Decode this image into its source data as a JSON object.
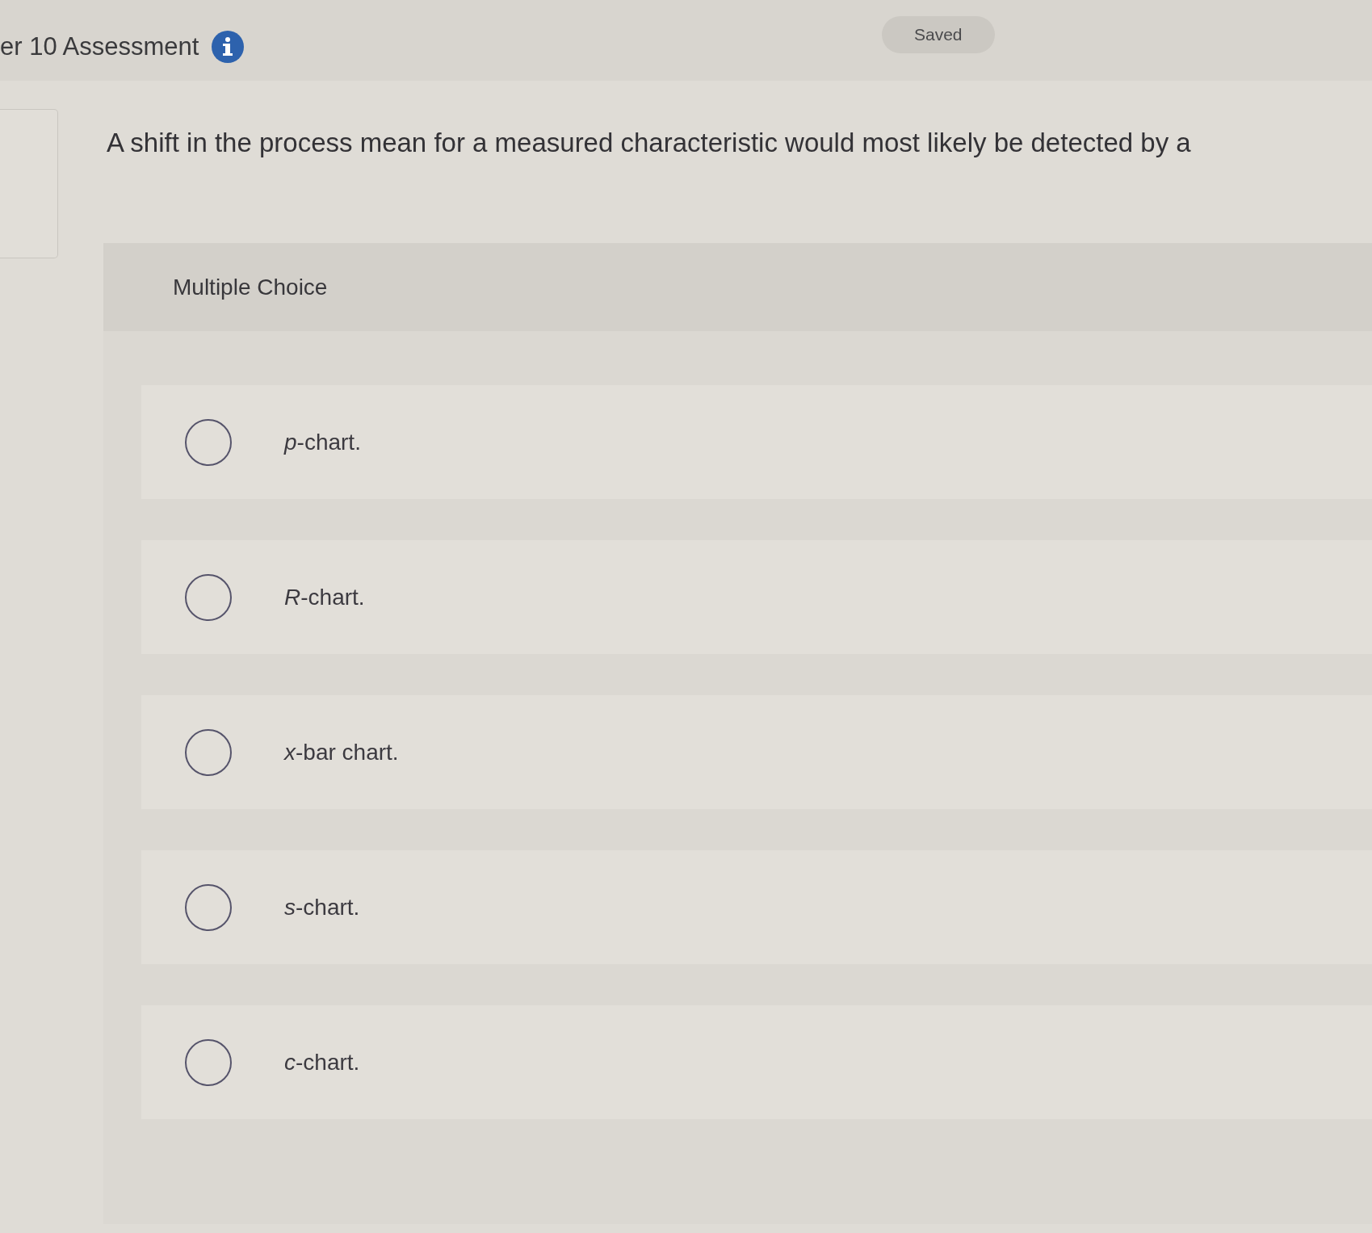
{
  "header": {
    "title": "er 10 Assessment",
    "status": "Saved"
  },
  "question": {
    "prompt": "A shift in the process mean for a measured characteristic would most likely be detected by a",
    "type_label": "Multiple Choice",
    "options": [
      {
        "label": "*p*-chart.",
        "selected": false
      },
      {
        "label": "*R*-chart.",
        "selected": false
      },
      {
        "label": "*x*-bar chart.",
        "selected": false
      },
      {
        "label": "*s*-chart.",
        "selected": false
      },
      {
        "label": "*c*-chart.",
        "selected": false
      }
    ]
  }
}
